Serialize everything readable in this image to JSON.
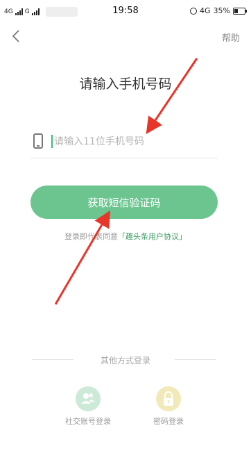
{
  "status_bar": {
    "network1": "4G",
    "network2": "G",
    "time": "19:58",
    "network_right": "4G",
    "battery": "35%"
  },
  "nav": {
    "back_icon": "chevron-left-icon",
    "help_label": "帮助"
  },
  "title": "请输入手机号码",
  "phone": {
    "icon": "phone-icon",
    "placeholder": "请输入11位手机号码",
    "value": ""
  },
  "get_code_button": "获取短信验证码",
  "agreement": {
    "prefix": "登录即代表同意",
    "link": "「趣头条用户协议」"
  },
  "other_login": {
    "heading": "其他方式登录",
    "options": [
      {
        "icon": "user-group-icon",
        "label": "社交账号登录"
      },
      {
        "icon": "lock-icon",
        "label": "密码登录"
      }
    ]
  },
  "colors": {
    "accent": "#6cc58f",
    "link": "#3a9b62",
    "arrow": "#e8352a"
  }
}
